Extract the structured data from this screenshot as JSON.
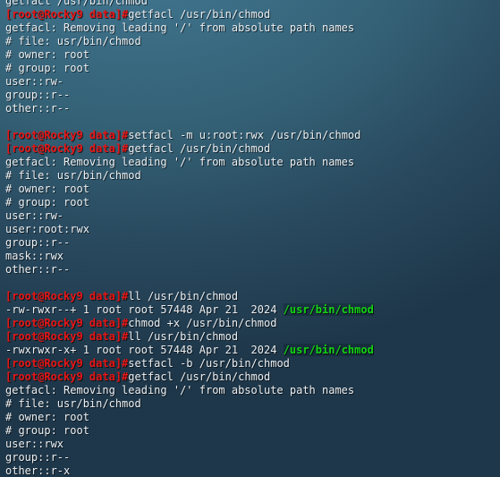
{
  "terminal": {
    "shell_prompt": "[root@Rocky9 data]#",
    "user": "root",
    "host": "Rocky9",
    "cwd": "data",
    "colors": {
      "prompt_red": "#ea1414",
      "default_text": "#eef2f5",
      "exec_green": "#12d612",
      "background_top": "#3c7089",
      "background_bottom": "#1d3649"
    },
    "lines": [
      {
        "segments": [
          {
            "text": "getfacl /usr/bin/chmod",
            "color": "default"
          }
        ]
      },
      {
        "segments": [
          {
            "text": "[root@Rocky9 data]#",
            "color": "prompt"
          },
          {
            "text": "getfacl /usr/bin/chmod",
            "color": "default"
          }
        ]
      },
      {
        "segments": [
          {
            "text": "getfacl: Removing leading '/' from absolute path names",
            "color": "default"
          }
        ]
      },
      {
        "segments": [
          {
            "text": "# file: usr/bin/chmod",
            "color": "default"
          }
        ]
      },
      {
        "segments": [
          {
            "text": "# owner: root",
            "color": "default"
          }
        ]
      },
      {
        "segments": [
          {
            "text": "# group: root",
            "color": "default"
          }
        ]
      },
      {
        "segments": [
          {
            "text": "user::rw-",
            "color": "default"
          }
        ]
      },
      {
        "segments": [
          {
            "text": "group::r--",
            "color": "default"
          }
        ]
      },
      {
        "segments": [
          {
            "text": "other::r--",
            "color": "default"
          }
        ]
      },
      {
        "segments": [
          {
            "text": "",
            "color": "default"
          }
        ]
      },
      {
        "segments": [
          {
            "text": "[root@Rocky9 data]#",
            "color": "prompt"
          },
          {
            "text": "setfacl -m u:root:rwx /usr/bin/chmod",
            "color": "default"
          }
        ]
      },
      {
        "segments": [
          {
            "text": "[root@Rocky9 data]#",
            "color": "prompt"
          },
          {
            "text": "getfacl /usr/bin/chmod",
            "color": "default"
          }
        ]
      },
      {
        "segments": [
          {
            "text": "getfacl: Removing leading '/' from absolute path names",
            "color": "default"
          }
        ]
      },
      {
        "segments": [
          {
            "text": "# file: usr/bin/chmod",
            "color": "default"
          }
        ]
      },
      {
        "segments": [
          {
            "text": "# owner: root",
            "color": "default"
          }
        ]
      },
      {
        "segments": [
          {
            "text": "# group: root",
            "color": "default"
          }
        ]
      },
      {
        "segments": [
          {
            "text": "user::rw-",
            "color": "default"
          }
        ]
      },
      {
        "segments": [
          {
            "text": "user:root:rwx",
            "color": "default"
          }
        ]
      },
      {
        "segments": [
          {
            "text": "group::r--",
            "color": "default"
          }
        ]
      },
      {
        "segments": [
          {
            "text": "mask::rwx",
            "color": "default"
          }
        ]
      },
      {
        "segments": [
          {
            "text": "other::r--",
            "color": "default"
          }
        ]
      },
      {
        "segments": [
          {
            "text": "",
            "color": "default"
          }
        ]
      },
      {
        "segments": [
          {
            "text": "[root@Rocky9 data]#",
            "color": "prompt"
          },
          {
            "text": "ll /usr/bin/chmod",
            "color": "default"
          }
        ]
      },
      {
        "segments": [
          {
            "text": "-rw-rwxr--+ 1 root root 57448 Apr 21  2024 ",
            "color": "default"
          },
          {
            "text": "/usr/bin/chmod",
            "color": "green"
          }
        ]
      },
      {
        "segments": [
          {
            "text": "[root@Rocky9 data]#",
            "color": "prompt"
          },
          {
            "text": "chmod +x /usr/bin/chmod",
            "color": "default"
          }
        ]
      },
      {
        "segments": [
          {
            "text": "[root@Rocky9 data]#",
            "color": "prompt"
          },
          {
            "text": "ll /usr/bin/chmod",
            "color": "default"
          }
        ]
      },
      {
        "segments": [
          {
            "text": "-rwxrwxr-x+ 1 root root 57448 Apr 21  2024 ",
            "color": "default"
          },
          {
            "text": "/usr/bin/chmod",
            "color": "green"
          }
        ]
      },
      {
        "segments": [
          {
            "text": "[root@Rocky9 data]#",
            "color": "prompt"
          },
          {
            "text": "setfacl -b /usr/bin/chmod",
            "color": "default"
          }
        ]
      },
      {
        "segments": [
          {
            "text": "[root@Rocky9 data]#",
            "color": "prompt"
          },
          {
            "text": "getfacl /usr/bin/chmod",
            "color": "default"
          }
        ]
      },
      {
        "segments": [
          {
            "text": "getfacl: Removing leading '/' from absolute path names",
            "color": "default"
          }
        ]
      },
      {
        "segments": [
          {
            "text": "# file: usr/bin/chmod",
            "color": "default"
          }
        ]
      },
      {
        "segments": [
          {
            "text": "# owner: root",
            "color": "default"
          }
        ]
      },
      {
        "segments": [
          {
            "text": "# group: root",
            "color": "default"
          }
        ]
      },
      {
        "segments": [
          {
            "text": "user::rwx",
            "color": "default"
          }
        ]
      },
      {
        "segments": [
          {
            "text": "group::r--",
            "color": "default"
          }
        ]
      },
      {
        "segments": [
          {
            "text": "other::r-x",
            "color": "default"
          }
        ]
      }
    ]
  }
}
